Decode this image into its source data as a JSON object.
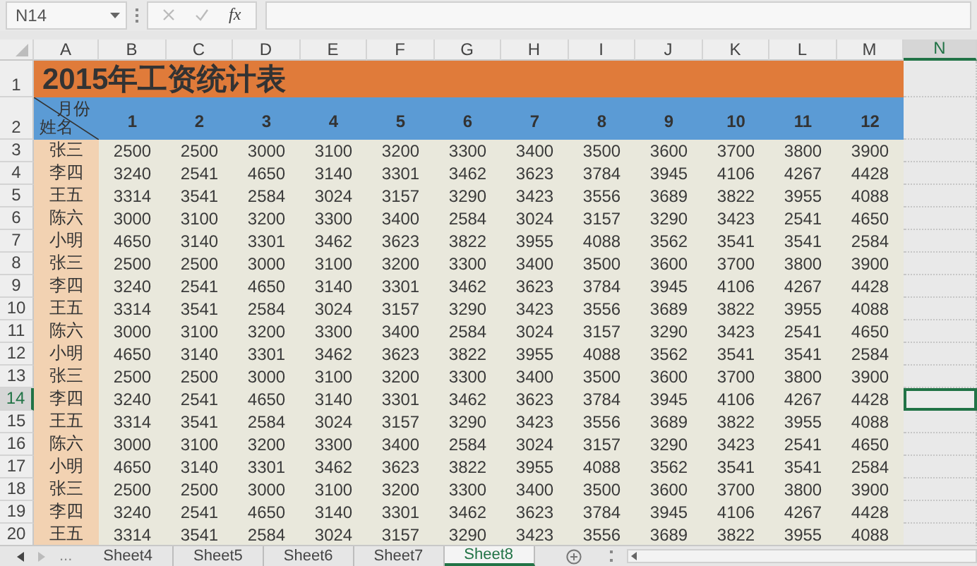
{
  "name_box": "N14",
  "formula_bar": {
    "function_label": "fx"
  },
  "columns": [
    {
      "label": "A",
      "selected": false
    },
    {
      "label": "B",
      "selected": false
    },
    {
      "label": "C",
      "selected": false
    },
    {
      "label": "D",
      "selected": false
    },
    {
      "label": "E",
      "selected": false
    },
    {
      "label": "F",
      "selected": false
    },
    {
      "label": "G",
      "selected": false
    },
    {
      "label": "H",
      "selected": false
    },
    {
      "label": "I",
      "selected": false
    },
    {
      "label": "J",
      "selected": false
    },
    {
      "label": "K",
      "selected": false
    },
    {
      "label": "L",
      "selected": false
    },
    {
      "label": "M",
      "selected": false
    },
    {
      "label": "N",
      "selected": true
    }
  ],
  "title_row": {
    "number": "1",
    "title": "2015年工资统计表"
  },
  "header_row": {
    "number": "2",
    "corner_top": "月份",
    "corner_bottom": "姓名",
    "months": [
      "1",
      "2",
      "3",
      "4",
      "5",
      "6",
      "7",
      "8",
      "9",
      "10",
      "11",
      "12"
    ]
  },
  "rows": [
    {
      "number": "3",
      "name": "张三",
      "values": [
        "2500",
        "2500",
        "3000",
        "3100",
        "3200",
        "3300",
        "3400",
        "3500",
        "3600",
        "3700",
        "3800",
        "3900"
      ],
      "selected": false
    },
    {
      "number": "4",
      "name": "李四",
      "values": [
        "3240",
        "2541",
        "4650",
        "3140",
        "3301",
        "3462",
        "3623",
        "3784",
        "3945",
        "4106",
        "4267",
        "4428"
      ],
      "selected": false
    },
    {
      "number": "5",
      "name": "王五",
      "values": [
        "3314",
        "3541",
        "2584",
        "3024",
        "3157",
        "3290",
        "3423",
        "3556",
        "3689",
        "3822",
        "3955",
        "4088"
      ],
      "selected": false
    },
    {
      "number": "6",
      "name": "陈六",
      "values": [
        "3000",
        "3100",
        "3200",
        "3300",
        "3400",
        "2584",
        "3024",
        "3157",
        "3290",
        "3423",
        "2541",
        "4650"
      ],
      "selected": false
    },
    {
      "number": "7",
      "name": "小明",
      "values": [
        "4650",
        "3140",
        "3301",
        "3462",
        "3623",
        "3822",
        "3955",
        "4088",
        "3562",
        "3541",
        "3541",
        "2584"
      ],
      "selected": false
    },
    {
      "number": "8",
      "name": "张三",
      "values": [
        "2500",
        "2500",
        "3000",
        "3100",
        "3200",
        "3300",
        "3400",
        "3500",
        "3600",
        "3700",
        "3800",
        "3900"
      ],
      "selected": false
    },
    {
      "number": "9",
      "name": "李四",
      "values": [
        "3240",
        "2541",
        "4650",
        "3140",
        "3301",
        "3462",
        "3623",
        "3784",
        "3945",
        "4106",
        "4267",
        "4428"
      ],
      "selected": false
    },
    {
      "number": "10",
      "name": "王五",
      "values": [
        "3314",
        "3541",
        "2584",
        "3024",
        "3157",
        "3290",
        "3423",
        "3556",
        "3689",
        "3822",
        "3955",
        "4088"
      ],
      "selected": false
    },
    {
      "number": "11",
      "name": "陈六",
      "values": [
        "3000",
        "3100",
        "3200",
        "3300",
        "3400",
        "2584",
        "3024",
        "3157",
        "3290",
        "3423",
        "2541",
        "4650"
      ],
      "selected": false
    },
    {
      "number": "12",
      "name": "小明",
      "values": [
        "4650",
        "3140",
        "3301",
        "3462",
        "3623",
        "3822",
        "3955",
        "4088",
        "3562",
        "3541",
        "3541",
        "2584"
      ],
      "selected": false
    },
    {
      "number": "13",
      "name": "张三",
      "values": [
        "2500",
        "2500",
        "3000",
        "3100",
        "3200",
        "3300",
        "3400",
        "3500",
        "3600",
        "3700",
        "3800",
        "3900"
      ],
      "selected": false
    },
    {
      "number": "14",
      "name": "李四",
      "values": [
        "3240",
        "2541",
        "4650",
        "3140",
        "3301",
        "3462",
        "3623",
        "3784",
        "3945",
        "4106",
        "4267",
        "4428"
      ],
      "selected": true
    },
    {
      "number": "15",
      "name": "王五",
      "values": [
        "3314",
        "3541",
        "2584",
        "3024",
        "3157",
        "3290",
        "3423",
        "3556",
        "3689",
        "3822",
        "3955",
        "4088"
      ],
      "selected": false
    },
    {
      "number": "16",
      "name": "陈六",
      "values": [
        "3000",
        "3100",
        "3200",
        "3300",
        "3400",
        "2584",
        "3024",
        "3157",
        "3290",
        "3423",
        "2541",
        "4650"
      ],
      "selected": false
    },
    {
      "number": "17",
      "name": "小明",
      "values": [
        "4650",
        "3140",
        "3301",
        "3462",
        "3623",
        "3822",
        "3955",
        "4088",
        "3562",
        "3541",
        "3541",
        "2584"
      ],
      "selected": false
    },
    {
      "number": "18",
      "name": "张三",
      "values": [
        "2500",
        "2500",
        "3000",
        "3100",
        "3200",
        "3300",
        "3400",
        "3500",
        "3600",
        "3700",
        "3800",
        "3900"
      ],
      "selected": false
    },
    {
      "number": "19",
      "name": "李四",
      "values": [
        "3240",
        "2541",
        "4650",
        "3140",
        "3301",
        "3462",
        "3623",
        "3784",
        "3945",
        "4106",
        "4267",
        "4428"
      ],
      "selected": false
    },
    {
      "number": "20",
      "name": "王五",
      "values": [
        "3314",
        "3541",
        "2584",
        "3024",
        "3157",
        "3290",
        "3423",
        "3556",
        "3689",
        "3822",
        "3955",
        "4088"
      ],
      "selected": false
    }
  ],
  "sheet_tabs": {
    "overflow": "...",
    "tabs": [
      {
        "label": "Sheet4",
        "selected": false
      },
      {
        "label": "Sheet5",
        "selected": false
      },
      {
        "label": "Sheet6",
        "selected": false
      },
      {
        "label": "Sheet7",
        "selected": false
      },
      {
        "label": "Sheet8",
        "selected": true
      }
    ]
  }
}
